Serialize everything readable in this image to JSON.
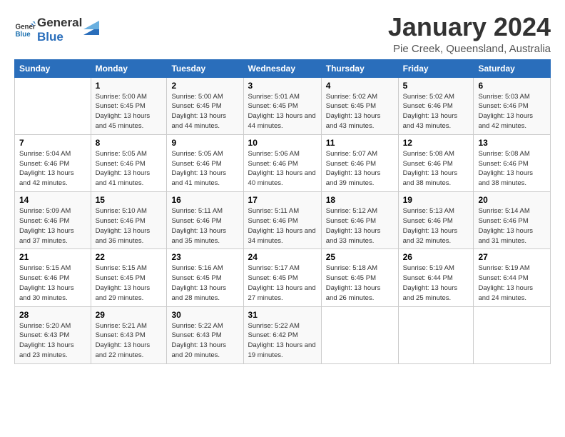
{
  "logo": {
    "line1": "General",
    "line2": "Blue"
  },
  "title": "January 2024",
  "location": "Pie Creek, Queensland, Australia",
  "days_header": [
    "Sunday",
    "Monday",
    "Tuesday",
    "Wednesday",
    "Thursday",
    "Friday",
    "Saturday"
  ],
  "weeks": [
    [
      {
        "day": "",
        "sunrise": "",
        "sunset": "",
        "daylight": ""
      },
      {
        "day": "1",
        "sunrise": "Sunrise: 5:00 AM",
        "sunset": "Sunset: 6:45 PM",
        "daylight": "Daylight: 13 hours and 45 minutes."
      },
      {
        "day": "2",
        "sunrise": "Sunrise: 5:00 AM",
        "sunset": "Sunset: 6:45 PM",
        "daylight": "Daylight: 13 hours and 44 minutes."
      },
      {
        "day": "3",
        "sunrise": "Sunrise: 5:01 AM",
        "sunset": "Sunset: 6:45 PM",
        "daylight": "Daylight: 13 hours and 44 minutes."
      },
      {
        "day": "4",
        "sunrise": "Sunrise: 5:02 AM",
        "sunset": "Sunset: 6:45 PM",
        "daylight": "Daylight: 13 hours and 43 minutes."
      },
      {
        "day": "5",
        "sunrise": "Sunrise: 5:02 AM",
        "sunset": "Sunset: 6:46 PM",
        "daylight": "Daylight: 13 hours and 43 minutes."
      },
      {
        "day": "6",
        "sunrise": "Sunrise: 5:03 AM",
        "sunset": "Sunset: 6:46 PM",
        "daylight": "Daylight: 13 hours and 42 minutes."
      }
    ],
    [
      {
        "day": "7",
        "sunrise": "Sunrise: 5:04 AM",
        "sunset": "Sunset: 6:46 PM",
        "daylight": "Daylight: 13 hours and 42 minutes."
      },
      {
        "day": "8",
        "sunrise": "Sunrise: 5:05 AM",
        "sunset": "Sunset: 6:46 PM",
        "daylight": "Daylight: 13 hours and 41 minutes."
      },
      {
        "day": "9",
        "sunrise": "Sunrise: 5:05 AM",
        "sunset": "Sunset: 6:46 PM",
        "daylight": "Daylight: 13 hours and 41 minutes."
      },
      {
        "day": "10",
        "sunrise": "Sunrise: 5:06 AM",
        "sunset": "Sunset: 6:46 PM",
        "daylight": "Daylight: 13 hours and 40 minutes."
      },
      {
        "day": "11",
        "sunrise": "Sunrise: 5:07 AM",
        "sunset": "Sunset: 6:46 PM",
        "daylight": "Daylight: 13 hours and 39 minutes."
      },
      {
        "day": "12",
        "sunrise": "Sunrise: 5:08 AM",
        "sunset": "Sunset: 6:46 PM",
        "daylight": "Daylight: 13 hours and 38 minutes."
      },
      {
        "day": "13",
        "sunrise": "Sunrise: 5:08 AM",
        "sunset": "Sunset: 6:46 PM",
        "daylight": "Daylight: 13 hours and 38 minutes."
      }
    ],
    [
      {
        "day": "14",
        "sunrise": "Sunrise: 5:09 AM",
        "sunset": "Sunset: 6:46 PM",
        "daylight": "Daylight: 13 hours and 37 minutes."
      },
      {
        "day": "15",
        "sunrise": "Sunrise: 5:10 AM",
        "sunset": "Sunset: 6:46 PM",
        "daylight": "Daylight: 13 hours and 36 minutes."
      },
      {
        "day": "16",
        "sunrise": "Sunrise: 5:11 AM",
        "sunset": "Sunset: 6:46 PM",
        "daylight": "Daylight: 13 hours and 35 minutes."
      },
      {
        "day": "17",
        "sunrise": "Sunrise: 5:11 AM",
        "sunset": "Sunset: 6:46 PM",
        "daylight": "Daylight: 13 hours and 34 minutes."
      },
      {
        "day": "18",
        "sunrise": "Sunrise: 5:12 AM",
        "sunset": "Sunset: 6:46 PM",
        "daylight": "Daylight: 13 hours and 33 minutes."
      },
      {
        "day": "19",
        "sunrise": "Sunrise: 5:13 AM",
        "sunset": "Sunset: 6:46 PM",
        "daylight": "Daylight: 13 hours and 32 minutes."
      },
      {
        "day": "20",
        "sunrise": "Sunrise: 5:14 AM",
        "sunset": "Sunset: 6:46 PM",
        "daylight": "Daylight: 13 hours and 31 minutes."
      }
    ],
    [
      {
        "day": "21",
        "sunrise": "Sunrise: 5:15 AM",
        "sunset": "Sunset: 6:46 PM",
        "daylight": "Daylight: 13 hours and 30 minutes."
      },
      {
        "day": "22",
        "sunrise": "Sunrise: 5:15 AM",
        "sunset": "Sunset: 6:45 PM",
        "daylight": "Daylight: 13 hours and 29 minutes."
      },
      {
        "day": "23",
        "sunrise": "Sunrise: 5:16 AM",
        "sunset": "Sunset: 6:45 PM",
        "daylight": "Daylight: 13 hours and 28 minutes."
      },
      {
        "day": "24",
        "sunrise": "Sunrise: 5:17 AM",
        "sunset": "Sunset: 6:45 PM",
        "daylight": "Daylight: 13 hours and 27 minutes."
      },
      {
        "day": "25",
        "sunrise": "Sunrise: 5:18 AM",
        "sunset": "Sunset: 6:45 PM",
        "daylight": "Daylight: 13 hours and 26 minutes."
      },
      {
        "day": "26",
        "sunrise": "Sunrise: 5:19 AM",
        "sunset": "Sunset: 6:44 PM",
        "daylight": "Daylight: 13 hours and 25 minutes."
      },
      {
        "day": "27",
        "sunrise": "Sunrise: 5:19 AM",
        "sunset": "Sunset: 6:44 PM",
        "daylight": "Daylight: 13 hours and 24 minutes."
      }
    ],
    [
      {
        "day": "28",
        "sunrise": "Sunrise: 5:20 AM",
        "sunset": "Sunset: 6:43 PM",
        "daylight": "Daylight: 13 hours and 23 minutes."
      },
      {
        "day": "29",
        "sunrise": "Sunrise: 5:21 AM",
        "sunset": "Sunset: 6:43 PM",
        "daylight": "Daylight: 13 hours and 22 minutes."
      },
      {
        "day": "30",
        "sunrise": "Sunrise: 5:22 AM",
        "sunset": "Sunset: 6:43 PM",
        "daylight": "Daylight: 13 hours and 20 minutes."
      },
      {
        "day": "31",
        "sunrise": "Sunrise: 5:22 AM",
        "sunset": "Sunset: 6:42 PM",
        "daylight": "Daylight: 13 hours and 19 minutes."
      },
      {
        "day": "",
        "sunrise": "",
        "sunset": "",
        "daylight": ""
      },
      {
        "day": "",
        "sunrise": "",
        "sunset": "",
        "daylight": ""
      },
      {
        "day": "",
        "sunrise": "",
        "sunset": "",
        "daylight": ""
      }
    ]
  ]
}
